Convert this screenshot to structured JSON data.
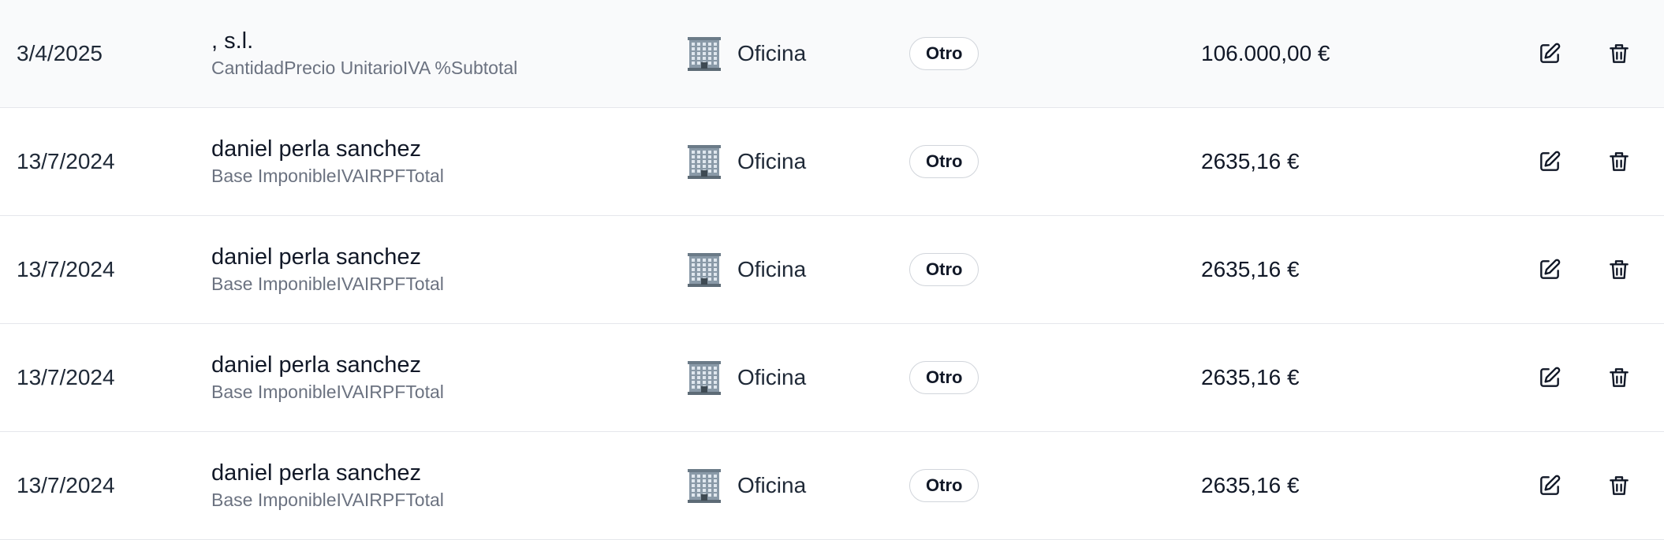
{
  "rows": [
    {
      "date": "3/4/2025",
      "title": ", s.l.",
      "subtitle": "CantidadPrecio UnitarioIVA %Subtotal",
      "category": "Oficina",
      "category_icon": "building-icon",
      "type": "Otro",
      "amount": "106.000,00 €",
      "highlighted": true
    },
    {
      "date": "13/7/2024",
      "title": "daniel perla sanchez",
      "subtitle": "Base ImponibleIVAIRPFTotal",
      "category": "Oficina",
      "category_icon": "building-icon",
      "type": "Otro",
      "amount": "2635,16 €",
      "highlighted": false
    },
    {
      "date": "13/7/2024",
      "title": "daniel perla sanchez",
      "subtitle": "Base ImponibleIVAIRPFTotal",
      "category": "Oficina",
      "category_icon": "building-icon",
      "type": "Otro",
      "amount": "2635,16 €",
      "highlighted": false
    },
    {
      "date": "13/7/2024",
      "title": "daniel perla sanchez",
      "subtitle": "Base ImponibleIVAIRPFTotal",
      "category": "Oficina",
      "category_icon": "building-icon",
      "type": "Otro",
      "amount": "2635,16 €",
      "highlighted": false
    },
    {
      "date": "13/7/2024",
      "title": "daniel perla sanchez",
      "subtitle": "Base ImponibleIVAIRPFTotal",
      "category": "Oficina",
      "category_icon": "building-icon",
      "type": "Otro",
      "amount": "2635,16 €",
      "highlighted": false
    }
  ],
  "actions": {
    "edit_icon": "edit-icon",
    "delete_icon": "trash-icon"
  },
  "colors": {
    "row_highlight": "#f9fafb",
    "border": "#e5e7eb",
    "text_primary": "#111827",
    "text_secondary": "#6b7280",
    "badge_border": "#d1d5db"
  }
}
